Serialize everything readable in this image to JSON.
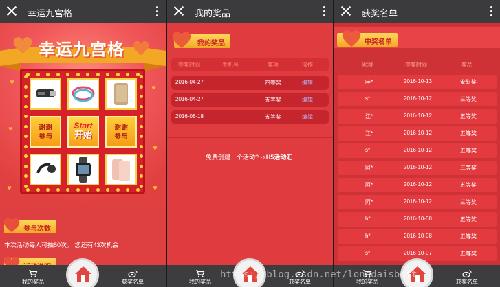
{
  "panels": {
    "lottery": {
      "title": "幸运九宫格",
      "logo_text": "幸运九宫格",
      "thanks_label": "谢谢\n参与",
      "start_en": "Start",
      "start_cn": "开始",
      "section_count": "参与次数",
      "section_rules": "活动说明",
      "info_text": "本次活动每人可抽50次。 您还有43次机会"
    },
    "my_prizes": {
      "title": "我的奖品",
      "section_label": "我的奖品",
      "columns": [
        "中奖时间",
        "手机号",
        "奖项",
        "操作"
      ],
      "rows": [
        {
          "date": "2016-04-27",
          "phone": "",
          "prize": "四等奖",
          "action": "编辑"
        },
        {
          "date": "2016-04-27",
          "phone": "",
          "prize": "五等奖",
          "action": "编辑"
        },
        {
          "date": "2016-08-18",
          "phone": "",
          "prize": "五等奖",
          "action": "编辑"
        }
      ],
      "promo_text": "免费创建一个活动? ->",
      "promo_link": "H5活动汇"
    },
    "winners": {
      "title": "获奖名单",
      "section_label": "中奖名单",
      "columns": [
        "昵称",
        "中奖时间",
        "奖品"
      ],
      "rows": [
        {
          "name": "哇*",
          "date": "2016-10-13",
          "prize": "安慰奖"
        },
        {
          "name": "s*",
          "date": "2016-10-12",
          "prize": "三等奖"
        },
        {
          "name": "江*",
          "date": "2016-10-12",
          "prize": "五等奖"
        },
        {
          "name": "江*",
          "date": "2016-10-12",
          "prize": "五等奖"
        },
        {
          "name": "s*",
          "date": "2016-10-12",
          "prize": "五等奖"
        },
        {
          "name": "阿*",
          "date": "2016-10-12",
          "prize": "三等奖"
        },
        {
          "name": "阿*",
          "date": "2016-10-12",
          "prize": "五等奖"
        },
        {
          "name": "阿*",
          "date": "2016-10-12",
          "prize": "三等奖"
        },
        {
          "name": "h*",
          "date": "2016-10-08",
          "prize": "五等奖"
        },
        {
          "name": "h*",
          "date": "2016-10-08",
          "prize": "五等奖"
        },
        {
          "name": "s*",
          "date": "2016-10-07",
          "prize": "五等奖"
        }
      ]
    }
  },
  "bottom_nav": {
    "left_label": "我的奖品",
    "right_label": "获奖名单"
  },
  "watermark": "https://blog.csdn.net/longdaisbott",
  "colors": {
    "topbar": "#3b3b3d",
    "background": "#d93a3d",
    "gold": "#f3a825"
  }
}
